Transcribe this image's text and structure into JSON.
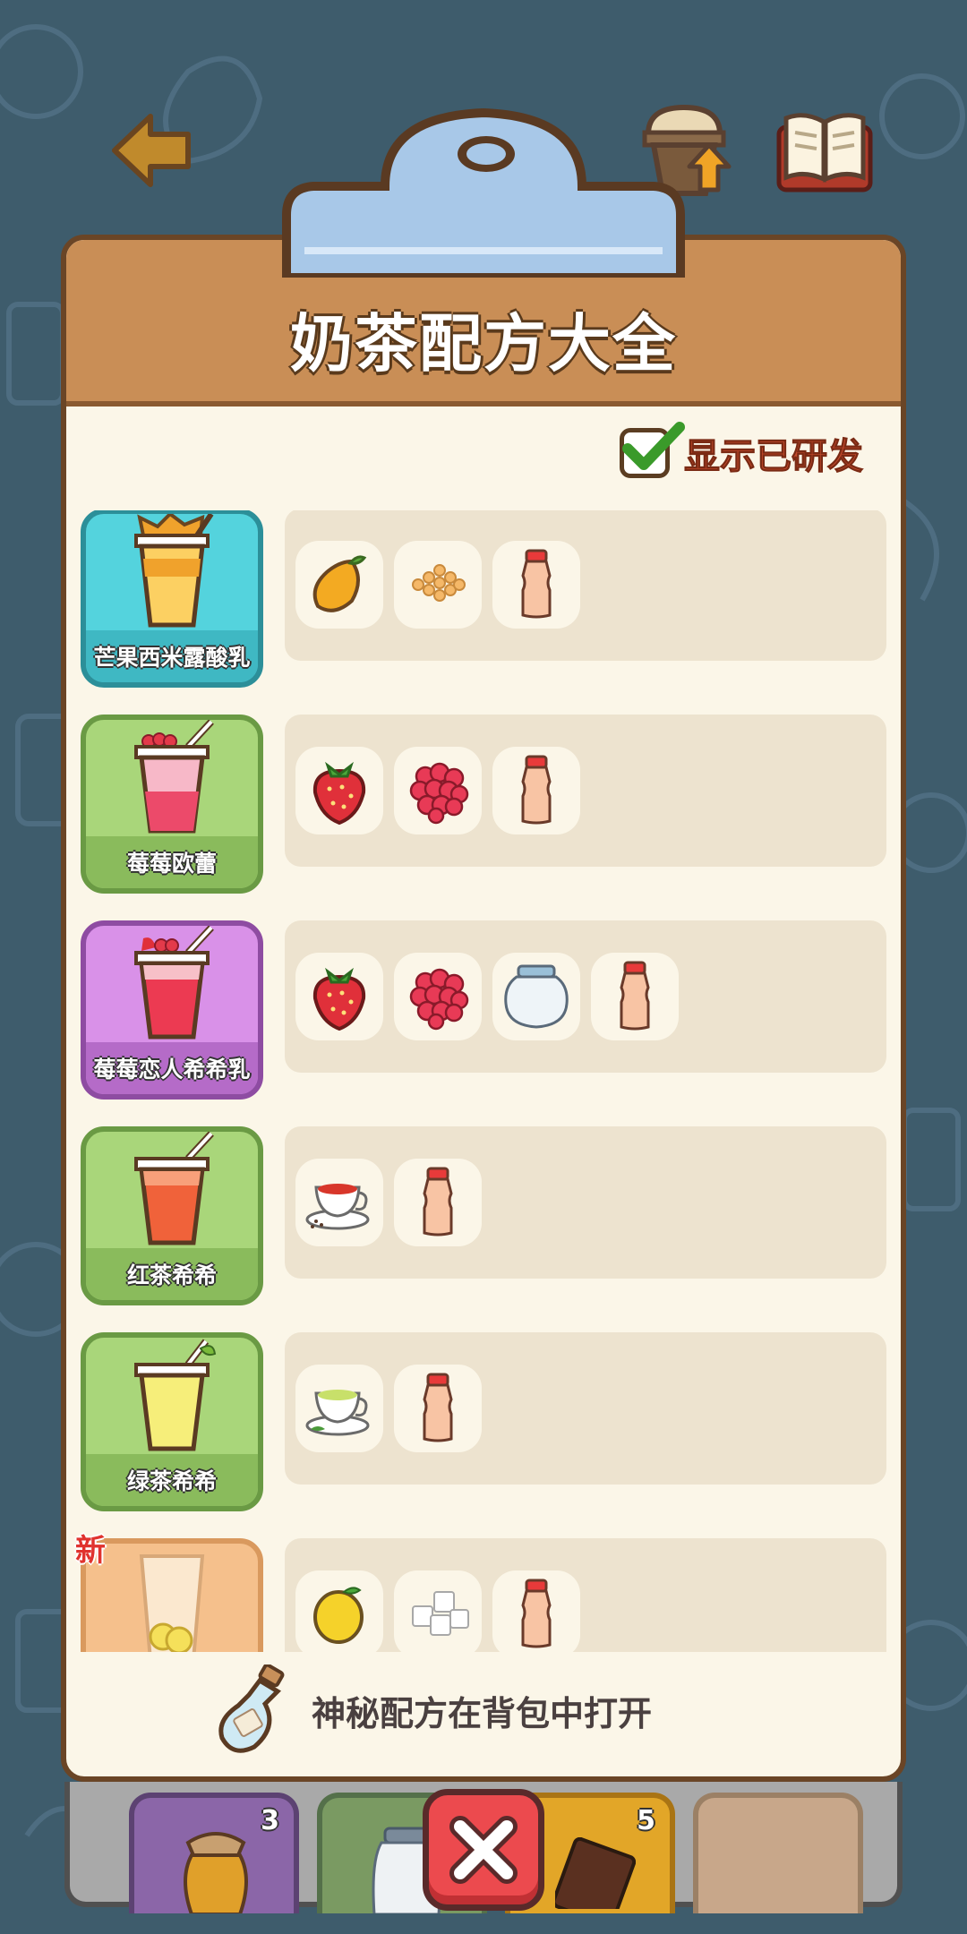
{
  "title": "奶茶配方大全",
  "toggle": {
    "label": "显示已研发",
    "checked": true
  },
  "recipes": [
    {
      "name": "芒果西米露酸乳",
      "card_color": "#54d3dd",
      "bar_color": "#3fb8c3",
      "border": "#2c8f99",
      "ingredients": [
        "mango-icon",
        "sago-pearls-icon",
        "yogurt-bottle-icon"
      ]
    },
    {
      "name": "莓莓欧蕾",
      "card_color": "#a9d67a",
      "bar_color": "#8abb5c",
      "border": "#6a9a44",
      "ingredients": [
        "strawberry-icon",
        "raspberry-icon",
        "yogurt-bottle-icon"
      ]
    },
    {
      "name": "莓莓恋人希希乳",
      "card_color": "#d991e8",
      "bar_color": "#b56bc8",
      "border": "#8e4ca2",
      "ingredients": [
        "strawberry-icon",
        "raspberry-icon",
        "milk-jar-icon",
        "yogurt-bottle-icon"
      ]
    },
    {
      "name": "红茶希希",
      "card_color": "#a9d67a",
      "bar_color": "#8abb5c",
      "border": "#6a9a44",
      "ingredients": [
        "black-tea-icon",
        "yogurt-bottle-icon"
      ]
    },
    {
      "name": "绿茶希希",
      "card_color": "#a9d67a",
      "bar_color": "#8abb5c",
      "border": "#6a9a44",
      "ingredients": [
        "green-tea-icon",
        "yogurt-bottle-icon"
      ]
    },
    {
      "name": "",
      "card_color": "#f5c08c",
      "bar_color": "#f5c08c",
      "border": "#d9995e",
      "badge": "新",
      "ingredients": [
        "lemon-icon",
        "sugar-cubes-icon",
        "yogurt-bottle-icon"
      ]
    }
  ],
  "footer": {
    "hint": "神秘配方在背包中打开"
  },
  "dock": {
    "slots": [
      {
        "color": "#8b66a8",
        "border": "#5c4272",
        "count": "3",
        "icon": "honey-jar-icon"
      },
      {
        "color": "#7a9a62",
        "border": "#54704a",
        "count": "",
        "icon": "milk-jar-icon"
      },
      {
        "color": "#e2a628",
        "border": "#a97414",
        "count": "5",
        "icon": "chocolate-icon"
      },
      {
        "color": "#c8a78a",
        "border": "#9b8065",
        "count": "",
        "icon": ""
      }
    ]
  }
}
